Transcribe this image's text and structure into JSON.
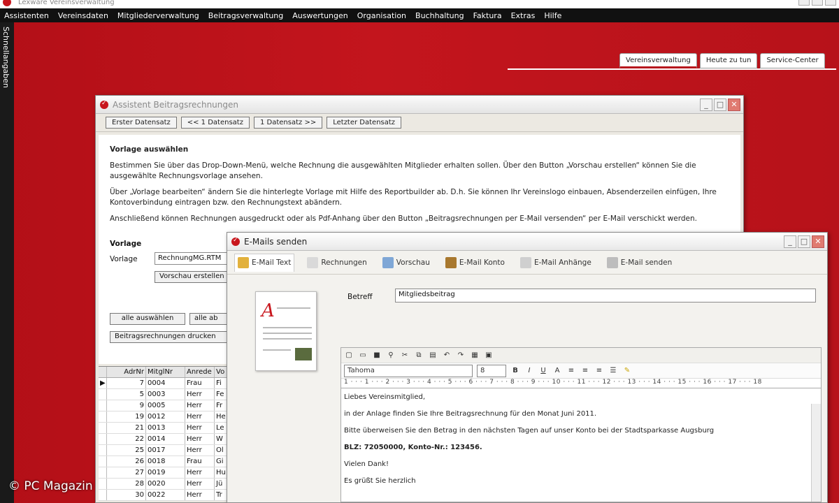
{
  "app": {
    "title": "Lexware Vereinsverwaltung"
  },
  "menu": [
    "Assistenten",
    "Vereinsdaten",
    "Mitgliederverwaltung",
    "Beitragsverwaltung",
    "Auswertungen",
    "Organisation",
    "Buchhaltung",
    "Faktura",
    "Extras",
    "Hilfe"
  ],
  "sidebar": {
    "label": "Schnellangaben"
  },
  "top_tabs": [
    "Vereinsverwaltung",
    "Heute zu tun",
    "Service-Center"
  ],
  "assistant": {
    "title": "Assistent Beitragsrechnungen",
    "nav": [
      "Erster Datensatz",
      "<< 1 Datensatz",
      "1 Datensatz >>",
      "Letzter Datensatz"
    ],
    "heading": "Vorlage auswählen",
    "para1": "Bestimmen Sie über das Drop-Down-Menü, welche Rechnung die ausgewählten Mitglieder erhalten sollen. Über den Button „Vorschau erstellen“ können Sie die ausgewählte Rechnungsvorlage ansehen.",
    "para2": "Über „Vorlage bearbeiten“ ändern Sie die hinterlegte Vorlage mit Hilfe des Reportbuilder ab. D.h. Sie können Ihr Vereinslogo einbauen, Absenderzeilen einfügen, Ihre Kontoverbindung eintragen bzw. den Rechnungstext abändern.",
    "para3": "Anschließend können Rechnungen ausgedruckt oder als Pdf-Anhang über den Button „Beitragsrechnungen per E-Mail versenden“ per E-Mail verschickt werden.",
    "vorlage_heading": "Vorlage",
    "vorlage_label": "Vorlage",
    "vorlage_value": "RechnungMG.RTM",
    "preview_button": "Vorschau erstellen",
    "select_all_button": "alle auswählen",
    "deselect_button": "alle ab",
    "print_button": "Beitragsrechnungen drucken",
    "grid_headers": [
      "",
      "AdrNr",
      "MitglNr",
      "Anrede",
      "Vo"
    ],
    "grid_rows": [
      [
        "▶",
        "7",
        "0004",
        "Frau",
        "Fi"
      ],
      [
        "",
        "5",
        "0003",
        "Herr",
        "Fe"
      ],
      [
        "",
        "9",
        "0005",
        "Herr",
        "Fr"
      ],
      [
        "",
        "19",
        "0012",
        "Herr",
        "He"
      ],
      [
        "",
        "21",
        "0013",
        "Herr",
        "Le"
      ],
      [
        "",
        "22",
        "0014",
        "Herr",
        "W"
      ],
      [
        "",
        "25",
        "0017",
        "Herr",
        "Ol"
      ],
      [
        "",
        "26",
        "0018",
        "Frau",
        "Gi"
      ],
      [
        "",
        "27",
        "0019",
        "Herr",
        "Hu"
      ],
      [
        "",
        "28",
        "0020",
        "Herr",
        "Jü"
      ],
      [
        "",
        "30",
        "0022",
        "Herr",
        "Tr"
      ]
    ]
  },
  "email": {
    "title": "E-Mails senden",
    "tabs": [
      "E-Mail Text",
      "Rechnungen",
      "Vorschau",
      "E-Mail Konto",
      "E-Mail Anhänge",
      "E-Mail senden"
    ],
    "subject_label": "Betreff",
    "subject_value": "Mitgliedsbeitrag",
    "font_name": "Tahoma",
    "font_size": "8",
    "ruler": "1 · · · 1 · · · 2 · · · 3 · · · 4 · · · 5 · · · 6 · · · 7 · · · 8 · · · 9 · · · 10 · · · 11 · · · 12 · · · 13 · · · 14 · · · 15 · · · 16 · · · 17 · · · 18",
    "body": [
      "Liebes Vereinsmitglied,",
      "in der Anlage finden Sie Ihre Beitragsrechnung für den Monat Juni 2011.",
      "Bitte überweisen Sie den Betrag in den nächsten Tagen auf unser Konto bei der Stadtsparkasse Augsburg",
      "BLZ: 72050000, Konto-Nr.: 123456.",
      "Vielen Dank!",
      "Es grüßt Sie herzlich"
    ]
  },
  "watermark": "© PC Magazin"
}
